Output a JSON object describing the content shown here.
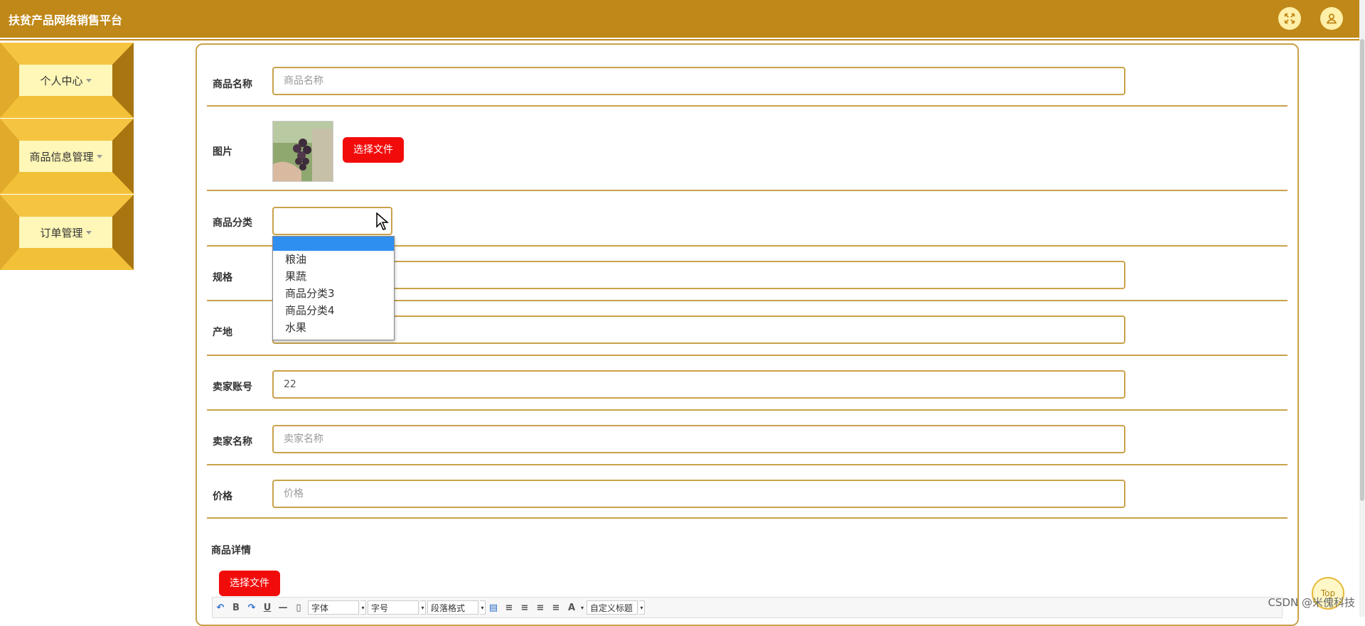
{
  "header": {
    "title": "扶贫产品网络销售平台",
    "fullscreen_icon": "fullscreen-icon",
    "user_icon": "user-icon"
  },
  "sidebar": {
    "items": [
      {
        "label": "个人中心"
      },
      {
        "label": "商品信息管理"
      },
      {
        "label": "订单管理"
      }
    ]
  },
  "form": {
    "name": {
      "label": "商品名称",
      "placeholder": "商品名称",
      "value": ""
    },
    "image": {
      "label": "图片",
      "button": "选择文件"
    },
    "category": {
      "label": "商品分类",
      "value": "",
      "options": [
        "",
        "粮油",
        "果蔬",
        "商品分类3",
        "商品分类4",
        "水果"
      ]
    },
    "spec": {
      "label": "规格",
      "placeholder": "",
      "value": ""
    },
    "origin": {
      "label": "产地",
      "placeholder": "",
      "value": ""
    },
    "seller_account": {
      "label": "卖家账号",
      "value": "22"
    },
    "seller_name": {
      "label": "卖家名称",
      "placeholder": "卖家名称",
      "value": ""
    },
    "price": {
      "label": "价格",
      "placeholder": "价格",
      "value": ""
    },
    "details": {
      "label": "商品详情",
      "button": "选择文件"
    }
  },
  "editor_toolbar": {
    "font_family": "字体",
    "font_size": "字号",
    "paragraph": "段落格式",
    "custom_title": "自定义标题"
  },
  "top_button": "Top",
  "watermark": "CSDN @米傀科技",
  "colors": {
    "header": "#bf8818",
    "accent_border": "#c9a24a",
    "button_red": "#f20b0b",
    "sidebar_face": "#fff7b8"
  }
}
